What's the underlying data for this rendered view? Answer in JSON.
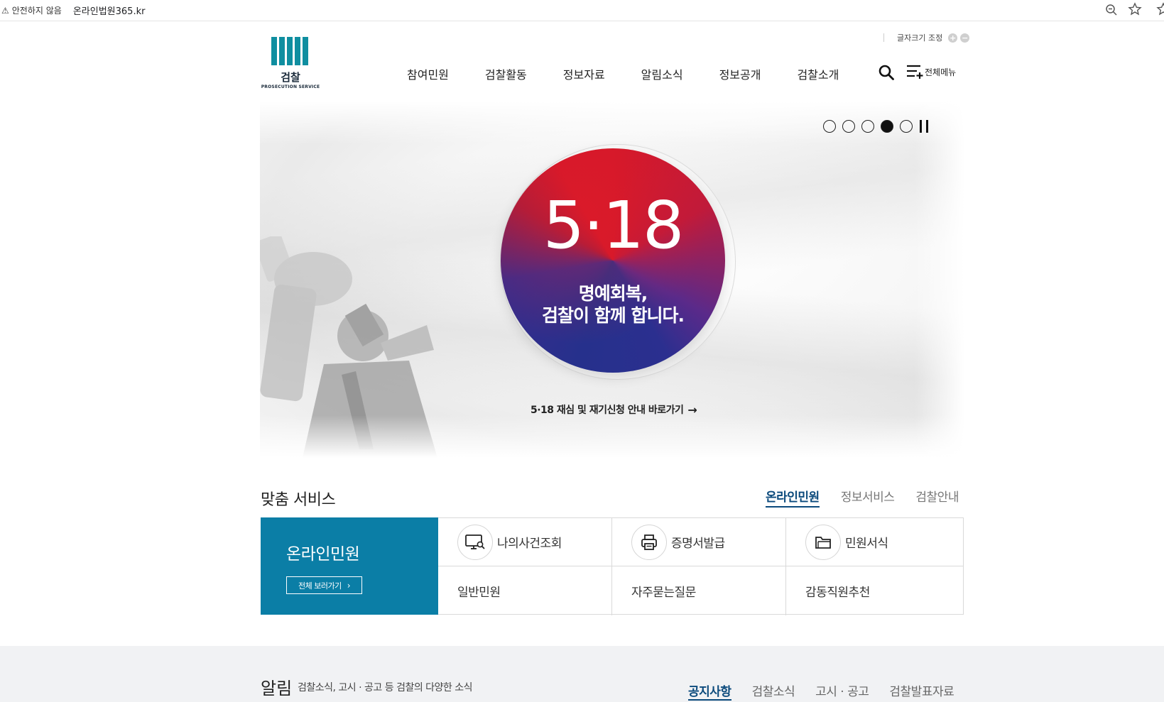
{
  "browser": {
    "warning": "⚠",
    "insecure": "안전하지 않음",
    "url": "온라인법원365.kr"
  },
  "header": {
    "logo_name": "검찰",
    "logo_sub": "PROSECUTION SERVICE",
    "fontsize_label": "글자크기 조정",
    "fontsize_plus": "+",
    "fontsize_minus": "−",
    "nav": [
      "참여민원",
      "검찰활동",
      "정보자료",
      "알림소식",
      "정보공개",
      "검찰소개"
    ],
    "allmenu_label": "전체메뉴"
  },
  "hero": {
    "big": "5·18",
    "msg_line1": "명예회복,",
    "msg_line2": "검찰이 함께 합니다.",
    "link": "5·18 재심 및 재기신청 안내 바로가기",
    "link_arrow": "→",
    "slides_total": 5,
    "slide_active": 4
  },
  "service": {
    "title": "맞춤 서비스",
    "tabs": [
      "온라인민원",
      "정보서비스",
      "검찰안내"
    ],
    "active_tab": 0,
    "panel_title": "온라인민원",
    "panel_button": "전체 보러가기",
    "panel_button_chevron": "›",
    "items": [
      {
        "label": "나의사건조회",
        "icon": "monitor-search-icon"
      },
      {
        "label": "증명서발급",
        "icon": "printer-icon"
      },
      {
        "label": "민원서식",
        "icon": "folder-icon"
      },
      {
        "label": "일반민원"
      },
      {
        "label": "자주묻는질문"
      },
      {
        "label": "감동직원추천"
      }
    ],
    "accent_color": "#0b7ea6"
  },
  "notice": {
    "title": "알림",
    "desc": "검찰소식, 고시 · 공고 등 검찰의 다양한 소식",
    "tabs": [
      "공지사항",
      "검찰소식",
      "고시 · 공고",
      "검찰발표자료"
    ],
    "active_tab": 0
  }
}
